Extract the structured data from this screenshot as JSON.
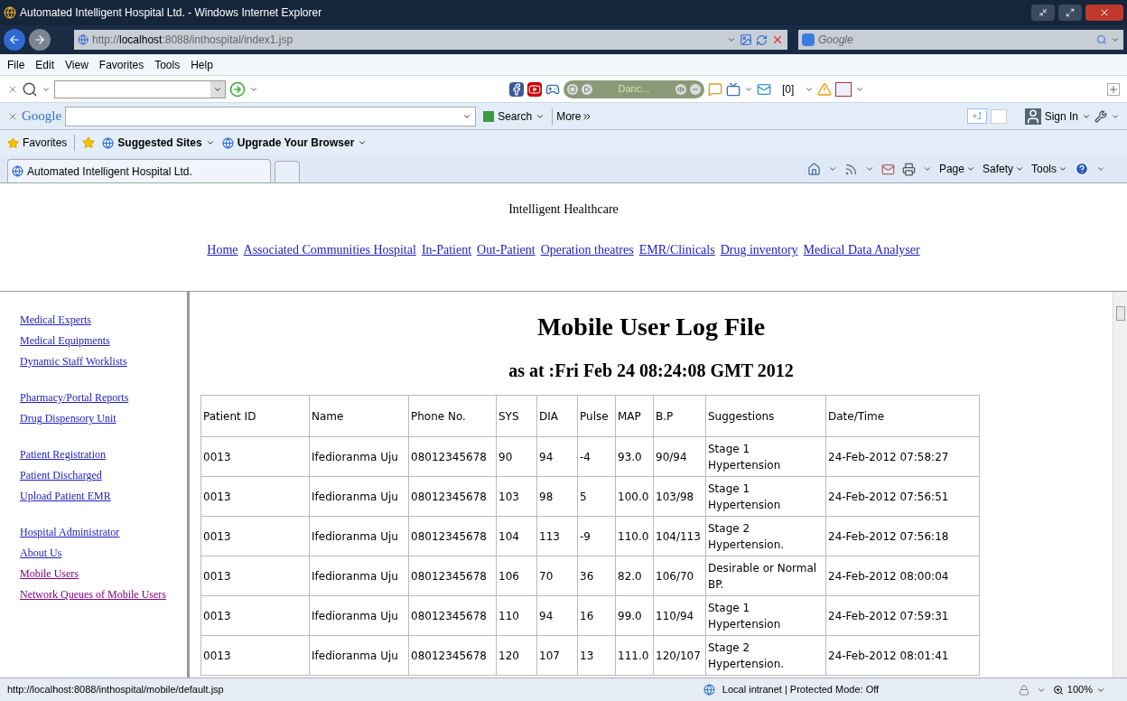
{
  "window": {
    "title": "Automated Intelligent Hospital Ltd. - Windows Internet Explorer"
  },
  "address_bar": {
    "url_prefix": "http://",
    "url_host": "localhost",
    "url_rest": ":8088/inthospital/index1.jsp",
    "search_placeholder": "Google"
  },
  "menu": [
    "File",
    "Edit",
    "View",
    "Favorites",
    "Tools",
    "Help"
  ],
  "toolbar": {
    "media_label": "Danc...",
    "counter": "[0]"
  },
  "google_bar": {
    "logo": "Google",
    "search_button": "Search",
    "more": "More",
    "plus_one": "+1",
    "sign_in": "Sign In"
  },
  "favorites_bar": {
    "favorites": "Favorites",
    "links": [
      "Suggested Sites",
      "Upgrade Your Browser"
    ]
  },
  "tab": {
    "title": "Automated Intelligent Hospital Ltd."
  },
  "command_bar": [
    "Page",
    "Safety",
    "Tools"
  ],
  "page": {
    "site_title": "Intelligent Healthcare",
    "nav": [
      "Home",
      "Associated Communities Hospital",
      "In-Patient",
      "Out-Patient",
      "Operation theatres",
      "EMR/Clinicals",
      "Drug inventory",
      "Medical Data Analyser"
    ],
    "sidebar": [
      [
        {
          "label": "Medical Experts",
          "visited": false
        },
        {
          "label": "Medical Equipments",
          "visited": false
        },
        {
          "label": "Dynamic Staff Worklists",
          "visited": false
        }
      ],
      [
        {
          "label": "Pharmacy/Portal Reports",
          "visited": false
        },
        {
          "label": "Drug Dispensory Unit",
          "visited": false
        }
      ],
      [
        {
          "label": "Patient Registration",
          "visited": false
        },
        {
          "label": "Patient Discharged",
          "visited": false
        },
        {
          "label": "Upload Patient EMR",
          "visited": false
        }
      ],
      [
        {
          "label": "Hospital Administrator",
          "visited": false
        },
        {
          "label": "About Us",
          "visited": false
        },
        {
          "label": "Mobile Users",
          "visited": true
        },
        {
          "label": "Network Queues of Mobile Users",
          "visited": true
        }
      ]
    ],
    "heading": "Mobile User Log File",
    "subheading": "as at :Fri Feb 24 08:24:08 GMT 2012",
    "table": {
      "columns": [
        "Patient ID",
        "Name",
        "Phone No.",
        "SYS",
        "DIA",
        "Pulse",
        "MAP",
        "B.P",
        "Suggestions",
        "Date/Time"
      ],
      "rows": [
        [
          "0013",
          "Ifedioranma Uju",
          "08012345678",
          "90",
          "94",
          "-4",
          "93.0",
          "90/94",
          "Stage 1 Hypertension",
          "24-Feb-2012 07:58:27"
        ],
        [
          "0013",
          "Ifedioranma Uju",
          "08012345678",
          "103",
          "98",
          "5",
          "100.0",
          "103/98",
          "Stage 1 Hypertension",
          "24-Feb-2012 07:56:51"
        ],
        [
          "0013",
          "Ifedioranma Uju",
          "08012345678",
          "104",
          "113",
          "-9",
          "110.0",
          "104/113",
          "Stage 2 Hypertension.",
          "24-Feb-2012 07:56:18"
        ],
        [
          "0013",
          "Ifedioranma Uju",
          "08012345678",
          "106",
          "70",
          "36",
          "82.0",
          "106/70",
          "Desirable or Normal BP.",
          "24-Feb-2012 08:00:04"
        ],
        [
          "0013",
          "Ifedioranma Uju",
          "08012345678",
          "110",
          "94",
          "16",
          "99.0",
          "110/94",
          "Stage 1 Hypertension",
          "24-Feb-2012 07:59:31"
        ],
        [
          "0013",
          "Ifedioranma Uju",
          "08012345678",
          "120",
          "107",
          "13",
          "111.0",
          "120/107",
          "Stage 2 Hypertension.",
          "24-Feb-2012 08:01:41"
        ]
      ]
    }
  },
  "status_bar": {
    "url": "http://localhost:8088/inthospital/mobile/default.jsp",
    "zone": "Local intranet | Protected Mode: Off",
    "zoom": "100%"
  }
}
